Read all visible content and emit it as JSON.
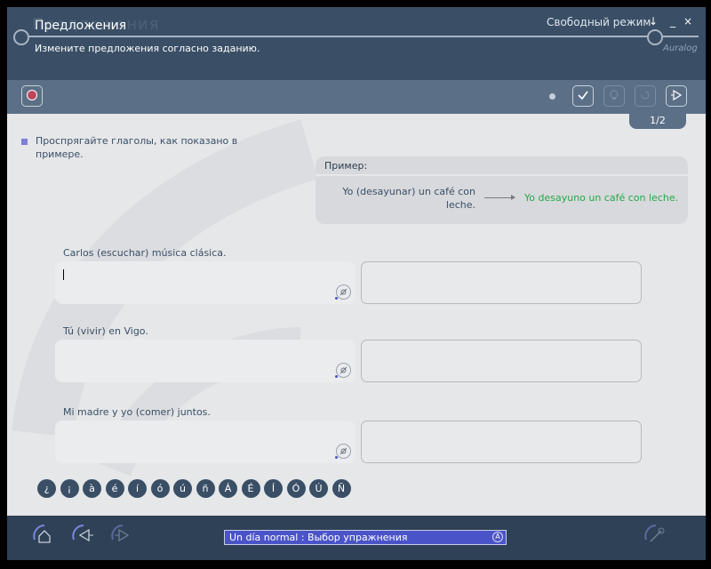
{
  "header": {
    "title": "Предложения",
    "subtitle": "Измените предложения согласно заданию.",
    "mode": "Свободный режим",
    "logo": "Auralog",
    "window_buttons": [
      "↓",
      "_",
      "×"
    ]
  },
  "toolbar": {
    "pager": "1/2"
  },
  "instruction": "Проспрягайте глаголы, как показано в примере.",
  "example": {
    "label": "Пример:",
    "source": "Yo (desayunar) un café con leche.",
    "result": "Yo desayuno un café con leche."
  },
  "questions": [
    {
      "prompt": "Carlos (escuchar) música clásica.",
      "answer": ""
    },
    {
      "prompt": "Tú (vivir) en Vigo.",
      "answer": ""
    },
    {
      "prompt": "Mi madre y yo (comer) juntos.",
      "answer": ""
    }
  ],
  "special_chars": [
    "¿",
    "¡",
    "à",
    "é",
    "í",
    "ó",
    "ú",
    "ñ",
    "Á",
    "É",
    "Í",
    "Ó",
    "Ú",
    "Ñ"
  ],
  "footer": {
    "status": "Un día normal : Выбор упражнения",
    "status_icon": "A"
  },
  "colors": {
    "header_bg": "#3a4f66",
    "toolbar_bg": "#5b7087",
    "accent": "#4a54c8",
    "correct_green": "#27a84a"
  }
}
